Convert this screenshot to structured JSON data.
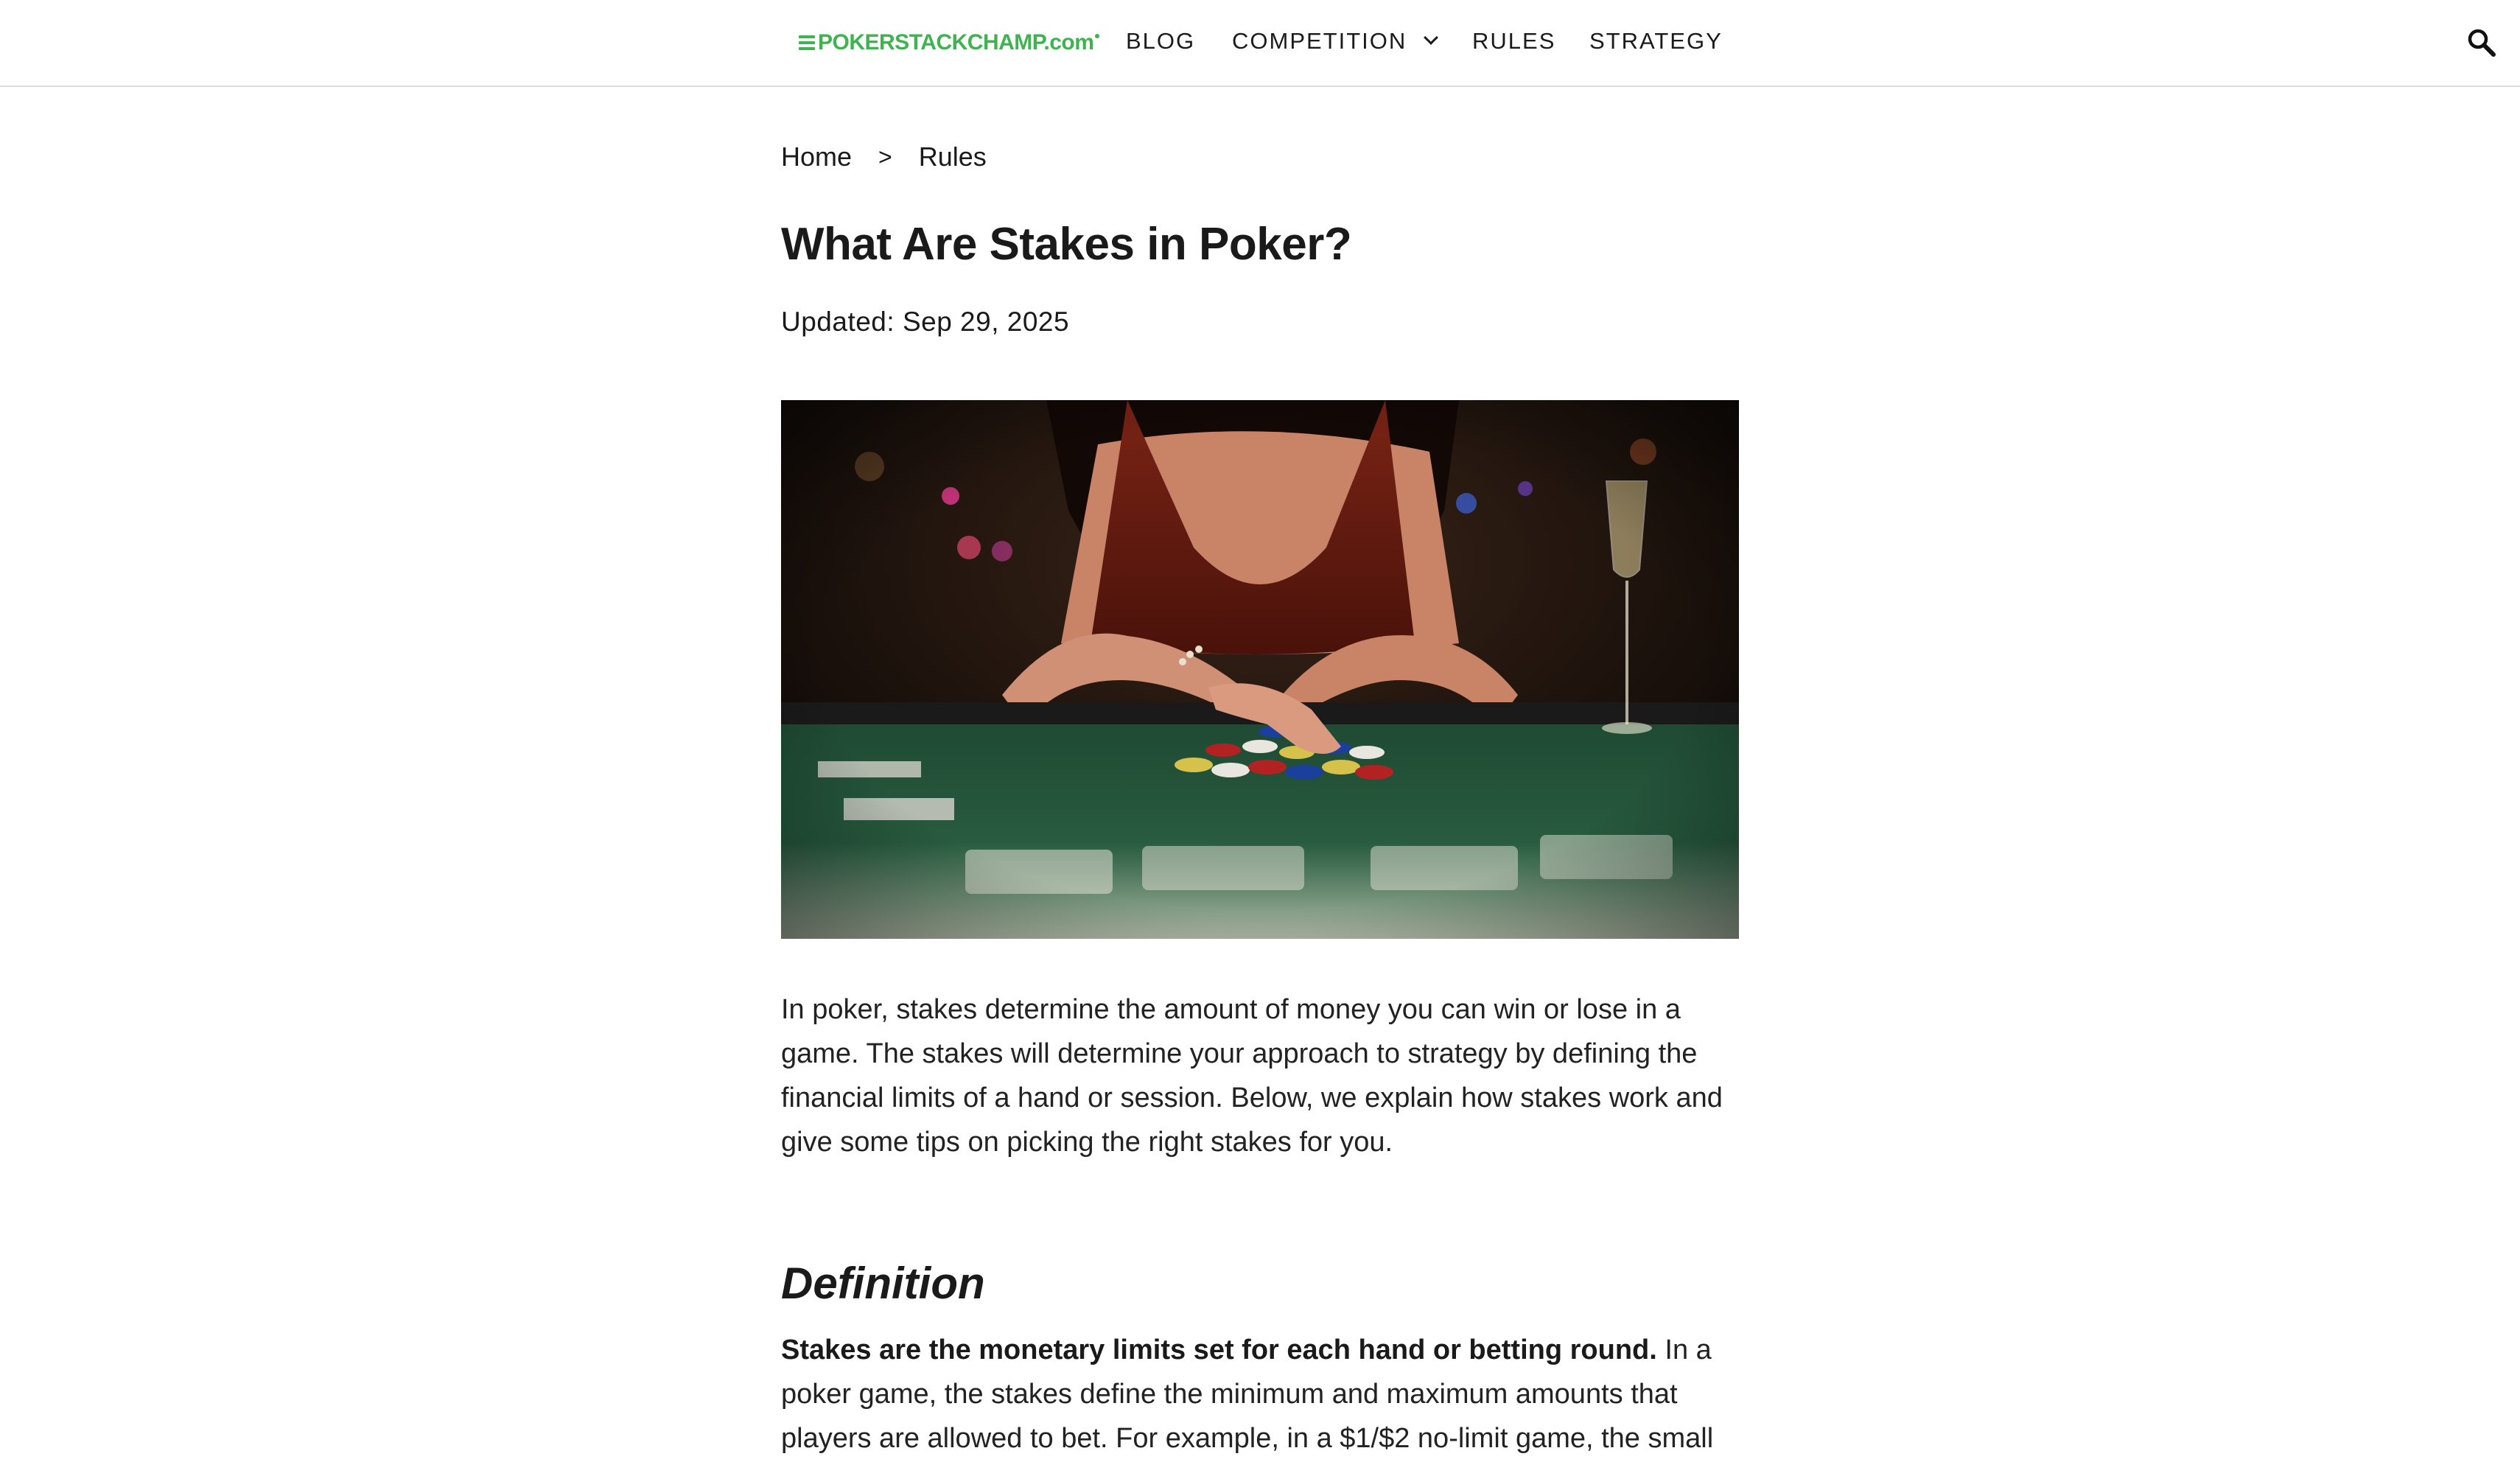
{
  "header": {
    "logo_text": "POKERSTACKCHAMP.com",
    "nav": {
      "blog": "BLOG",
      "competition": "COMPETITION",
      "rules": "RULES",
      "strategy": "STRATEGY"
    },
    "icons": {
      "search": "search-icon",
      "dropdown": "chevron-down-icon"
    }
  },
  "breadcrumb": {
    "home": "Home",
    "separator": ">",
    "current": "Rules"
  },
  "article": {
    "title": "What Are Stakes in Poker?",
    "updated": "Updated: Sep 29, 2025",
    "intro": "In poker, stakes determine the amount of money you can win or lose in a game. The stakes will determine your approach to strategy by defining the financial limits of a hand or session. Below, we explain how stakes work and give some tips on picking the right stakes for you.",
    "sections": [
      {
        "heading": "Definition",
        "lead": "Stakes are the monetary limits set for each hand or betting round.",
        "body": " In a poker game, the stakes define the minimum and maximum amounts that players are allowed to bet. For example, in a $1/$2 no-limit game, the small"
      }
    ]
  },
  "colors": {
    "brand": "#3fb34f",
    "text": "#1a1a1a",
    "header_border": "#dcdcdc"
  }
}
